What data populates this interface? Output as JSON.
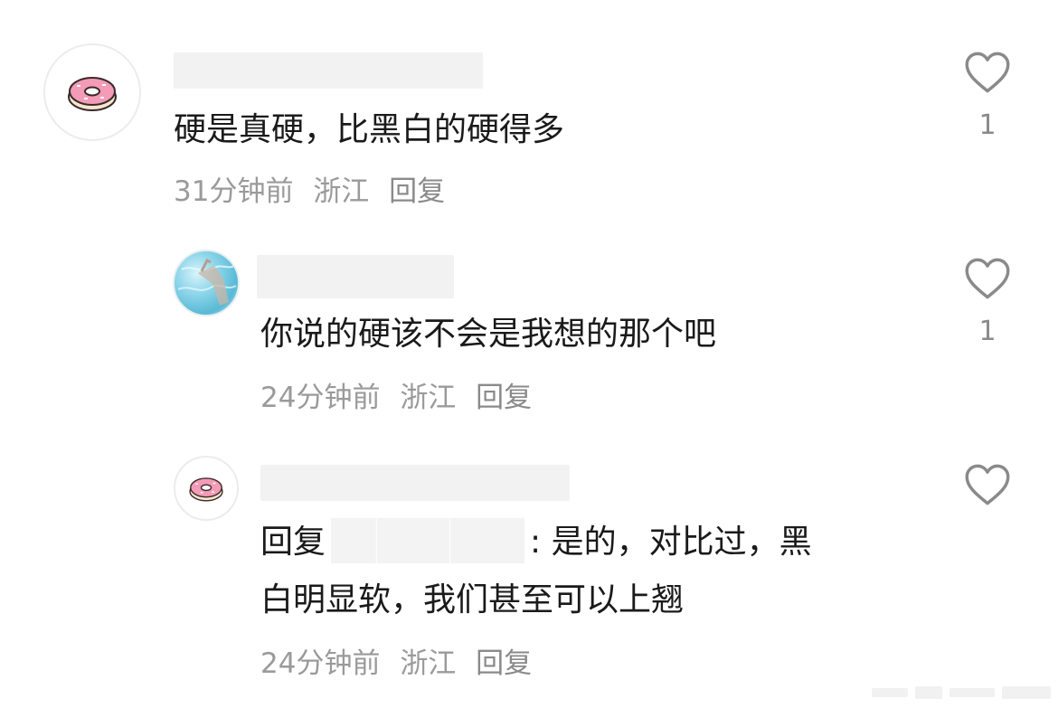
{
  "comments": [
    {
      "text": "硬是真硬，比黑白的硬得多",
      "time": "31分钟前",
      "location": "浙江",
      "reply_label": "回复",
      "likes": "1",
      "avatar_icon": "donut-icon"
    },
    {
      "text": "你说的硬该不会是我想的那个吧",
      "time": "24分钟前",
      "location": "浙江",
      "reply_label": "回复",
      "likes": "1",
      "avatar_icon": "pool-photo"
    },
    {
      "reply_prefix": "回复",
      "text_line1": ": 是的，对比过，黑",
      "text_line2": "白明显软，我们甚至可以上翘",
      "time": "24分钟前",
      "location": "浙江",
      "reply_label": "回复",
      "likes": "",
      "avatar_icon": "donut-icon"
    }
  ],
  "colors": {
    "text": "#1a1a1a",
    "meta": "#9a9a9a",
    "icon": "#8a8a8a",
    "donut_frosting": "#f39bb7"
  }
}
